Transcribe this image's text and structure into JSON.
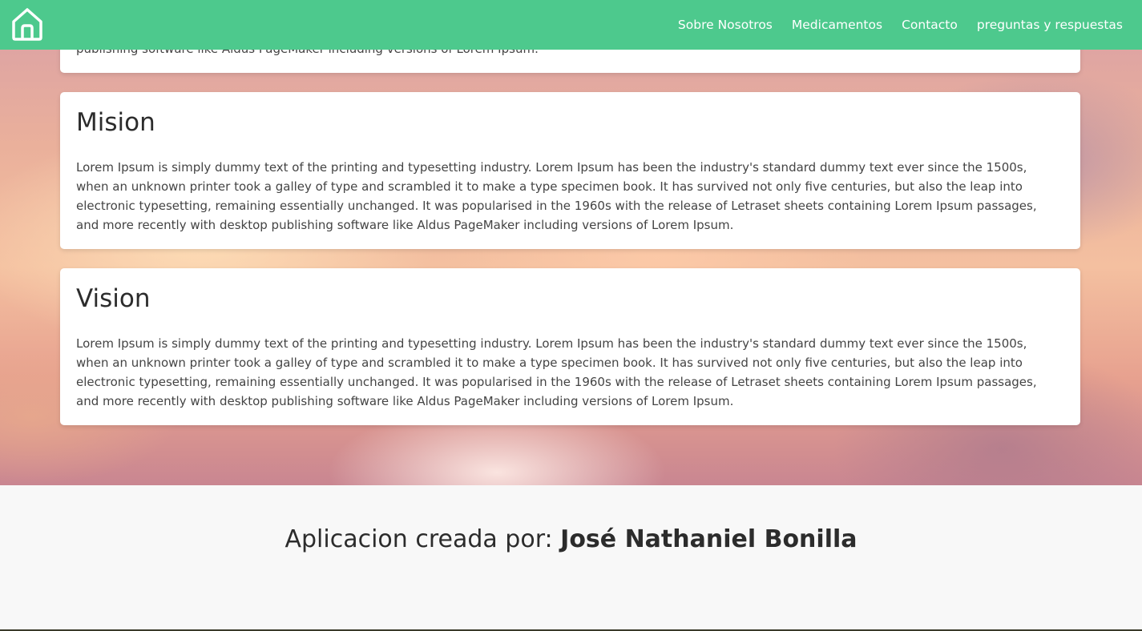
{
  "navbar": {
    "home_icon": "home-icon",
    "links": [
      {
        "label": "Sobre Nosotros"
      },
      {
        "label": "Medicamentos"
      },
      {
        "label": "Contacto"
      },
      {
        "label": "preguntas y respuestas"
      }
    ],
    "bg_color": "#4dc98d"
  },
  "cards": {
    "top_partial_text": "publishing software like Aldus PageMaker including versions of Lorem Ipsum.",
    "mision": {
      "title": "Mision",
      "body": "Lorem Ipsum is simply dummy text of the printing and typesetting industry. Lorem Ipsum has been the industry's standard dummy text ever since the 1500s, when an unknown printer took a galley of type and scrambled it to make a type specimen book. It has survived not only five centuries, but also the leap into electronic typesetting, remaining essentially unchanged. It was popularised in the 1960s with the release of Letraset sheets containing Lorem Ipsum passages, and more recently with desktop publishing software like Aldus PageMaker including versions of Lorem Ipsum."
    },
    "vision": {
      "title": "Vision",
      "body": "Lorem Ipsum is simply dummy text of the printing and typesetting industry. Lorem Ipsum has been the industry's standard dummy text ever since the 1500s, when an unknown printer took a galley of type and scrambled it to make a type specimen book. It has survived not only five centuries, but also the leap into electronic typesetting, remaining essentially unchanged. It was popularised in the 1960s with the release of Letraset sheets containing Lorem Ipsum passages, and more recently with desktop publishing software like Aldus PageMaker including versions of Lorem Ipsum."
    }
  },
  "footer": {
    "prefix": "Aplicacion creada por: ",
    "author": "José Nathaniel Bonilla"
  }
}
